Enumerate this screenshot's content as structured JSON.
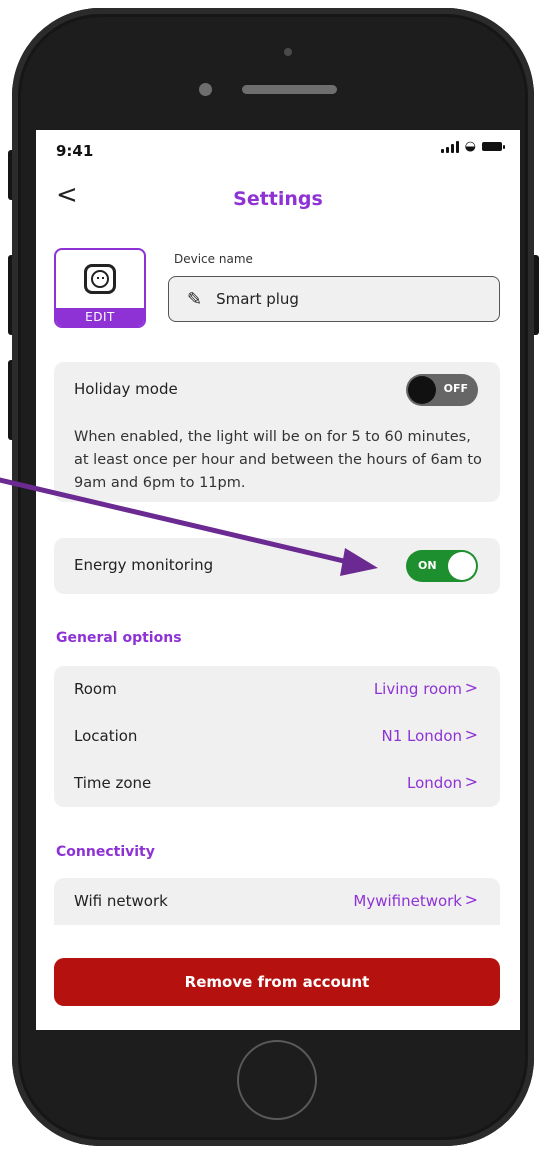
{
  "status_bar": {
    "time": "9:41"
  },
  "header": {
    "back_glyph": "<",
    "title": "Settings"
  },
  "device": {
    "edit_label": "EDIT",
    "name_label": "Device name",
    "name_value": "Smart plug"
  },
  "holiday": {
    "label": "Holiday mode",
    "toggle_label": "OFF",
    "toggle_on": false,
    "description": "When enabled, the light will be on for 5 to 60 minutes, at least once per hour and between the hours of 6am to 9am and 6pm to 11pm."
  },
  "energy": {
    "label": "Energy monitoring",
    "toggle_label": "ON",
    "toggle_on": true
  },
  "general_options": {
    "title": "General options",
    "rows": [
      {
        "label": "Room",
        "value": "Living room"
      },
      {
        "label": "Location",
        "value": "N1 London"
      },
      {
        "label": "Time zone",
        "value": "London"
      }
    ]
  },
  "connectivity": {
    "title": "Connectivity",
    "rows": [
      {
        "label": "Wifi network",
        "value": "Mywifinetwork"
      }
    ]
  },
  "remove_button": {
    "label": "Remove from account"
  },
  "chevron_glyph": ">",
  "colors": {
    "accent": "#8e32d6",
    "toggle_on": "#1e8f2e",
    "danger": "#b5120f",
    "annotation_arrow": "#6b2a91"
  },
  "icons": [
    "back-chevron-icon",
    "power-socket-icon",
    "pencil-edit-icon",
    "signal-icon",
    "wifi-icon",
    "battery-icon",
    "chevron-right-icon",
    "annotation-arrow"
  ]
}
